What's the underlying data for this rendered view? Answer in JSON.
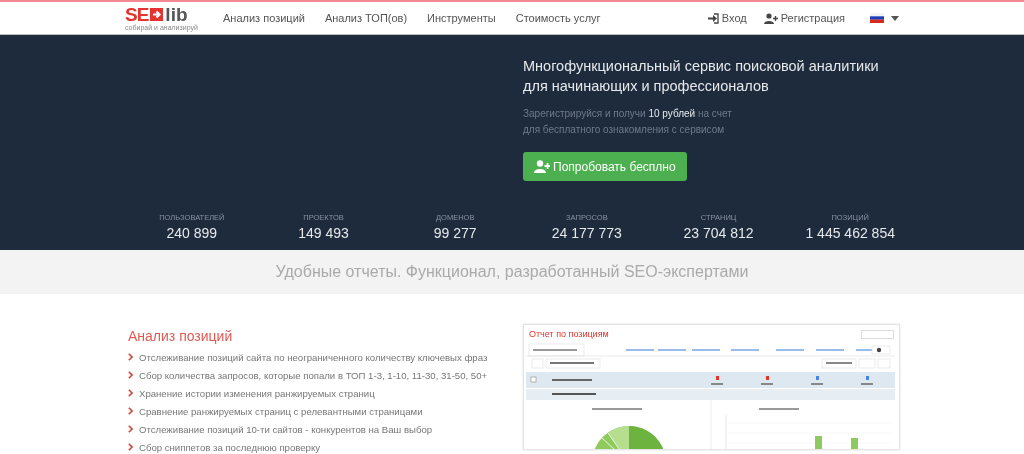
{
  "header": {
    "logo": {
      "left": "SE",
      "right": "lib",
      "tagline": "собирай и анализируй"
    },
    "nav": [
      "Анализ позиций",
      "Анализ ТОП(ов)",
      "Инструменты",
      "Стоимость услуг"
    ],
    "actions": [
      {
        "kind": "login",
        "label": "Вход"
      },
      {
        "kind": "register",
        "label": "Регистрация"
      }
    ]
  },
  "hero": {
    "title": "Многофункциональный сервис поисковой аналитики для начинающих и профессионалов",
    "lines": [
      "Зарегистрируйся и получи **10 рублей** на счет",
      "для бесплатного ознакомления с сервисом"
    ],
    "button": "Попробовать бесплно"
  },
  "stats": [
    {
      "label": "ПОЛЬЗОВАТЕЛЕЙ",
      "value": "240 899"
    },
    {
      "label": "ПРОЕКТОВ",
      "value": "149 493"
    },
    {
      "label": "ДОМЕНОВ",
      "value": "99 277"
    },
    {
      "label": "ЗАПРОСОВ",
      "value": "24 177 773"
    },
    {
      "label": "СТРАНИЦ",
      "value": "23 704 812"
    },
    {
      "label": "ПОЗИЦИЙ",
      "value": "1 445 462 854"
    }
  ],
  "band": "Удобные отчеты. Функционал, разработанный SEO-экспертами",
  "feature": {
    "title": "Анализ позиций",
    "items": [
      "Отслеживание позиций сайта по неограниченного количеству ключевых фраз",
      "Сбор количества запросов, которые попали в ТОП 1-3, 1-10, 11-30, 31-50, 50+",
      "Хранение истории изменения ранжируемых страниц",
      "Сравнение ранжируемых страниц с релевантными страницами",
      "Отслеживание позиций 10-ти сайтов - конкурентов на Ваш выбор",
      "Сбор сниппетов за последнюю проверку"
    ]
  },
  "report": {
    "title": "Отчет по позициям"
  }
}
